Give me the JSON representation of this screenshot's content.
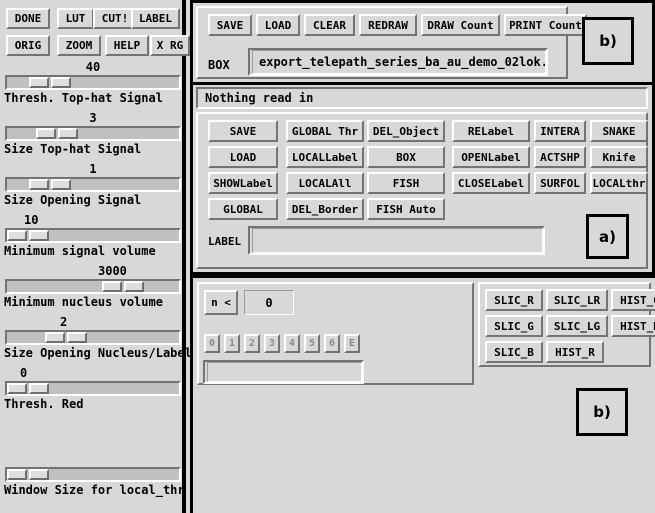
{
  "colors": {
    "background": "#d8d8d8",
    "shadow": "#737373",
    "highlight": "#ffffff",
    "border": "#000000",
    "disabled_text": "#8a8a8a"
  },
  "sidebar": {
    "top_buttons_row1": [
      {
        "label": "DONE"
      },
      {
        "label": "LUT"
      },
      {
        "label": "CUT!"
      },
      {
        "label": "LABEL"
      }
    ],
    "top_buttons_row2": [
      {
        "label": "ORIG"
      },
      {
        "label": "ZOOM"
      },
      {
        "label": "HELP"
      },
      {
        "label": "X RG"
      }
    ],
    "sliders": [
      {
        "value": "40",
        "label": "Thresh. Top-hat Signal",
        "thumb_pct": 13
      },
      {
        "value": "3",
        "label": "Size Top-hat Signal",
        "thumb_pct": 17
      },
      {
        "value": "1",
        "label": "Size Opening Signal",
        "thumb_pct": 13
      },
      {
        "value": "10",
        "label": "Minimum signal volume",
        "thumb_pct": 0
      },
      {
        "value": "3000",
        "label": "Minimum nucleus volume",
        "thumb_pct": 55
      },
      {
        "value": "2",
        "label": "Size Opening Nucleus/Label",
        "thumb_pct": 22
      },
      {
        "value": "0",
        "label": "Thresh. Red",
        "thumb_pct": 0
      },
      {
        "value": "",
        "label": "Window Size for local_thr",
        "thumb_pct": 0
      }
    ]
  },
  "top_panel": {
    "marker": "b)",
    "buttons": [
      {
        "label": "SAVE"
      },
      {
        "label": "LOAD"
      },
      {
        "label": "CLEAR"
      },
      {
        "label": "REDRAW"
      },
      {
        "label": "DRAW Count"
      },
      {
        "label": "PRINT Count"
      }
    ],
    "box_label": "BOX",
    "box_value": "export_telepath_series_ba_au_demo_02lok.",
    "box_placeholder": ""
  },
  "middle_panel": {
    "marker": "a)",
    "status": "Nothing read in",
    "buttons": [
      {
        "label": "SAVE"
      },
      {
        "label": "GLOBAL Thr"
      },
      {
        "label": "DEL_Object"
      },
      {
        "label": "RELabel"
      },
      {
        "label": "INTERA"
      },
      {
        "label": "SNAKE"
      },
      {
        "label": "LOAD"
      },
      {
        "label": "LOCALLabel"
      },
      {
        "label": "BOX"
      },
      {
        "label": "OPENLabel"
      },
      {
        "label": "ACTSHP"
      },
      {
        "label": "Knife"
      },
      {
        "label": "SHOWLabel"
      },
      {
        "label": "LOCALAll"
      },
      {
        "label": "FISH"
      },
      {
        "label": "CLOSELabel"
      },
      {
        "label": "SURFOL"
      },
      {
        "label": "LOCALthr"
      },
      {
        "label": "GLOBAL"
      },
      {
        "label": "DEL_Border"
      },
      {
        "label": "FISH Auto"
      }
    ],
    "label_field_label": "LABEL",
    "label_field_value": "",
    "label_field_placeholder": ""
  },
  "bottom_panel": {
    "marker": "b)",
    "stepper_label": "n <",
    "stepper_value": "0",
    "num_buttons": [
      {
        "label": "0"
      },
      {
        "label": "1"
      },
      {
        "label": "2"
      },
      {
        "label": "3"
      },
      {
        "label": "4"
      },
      {
        "label": "5"
      },
      {
        "label": "6"
      },
      {
        "label": "E"
      }
    ],
    "text_value": "",
    "text_placeholder": "",
    "slice_buttons": [
      {
        "label": "SLIC_R"
      },
      {
        "label": "SLIC_LR"
      },
      {
        "label": "HIST_G"
      },
      {
        "label": "SLIC_G"
      },
      {
        "label": "SLIC_LG"
      },
      {
        "label": "HIST_B"
      },
      {
        "label": "SLIC_B"
      },
      {
        "label": "HIST_R"
      }
    ]
  }
}
